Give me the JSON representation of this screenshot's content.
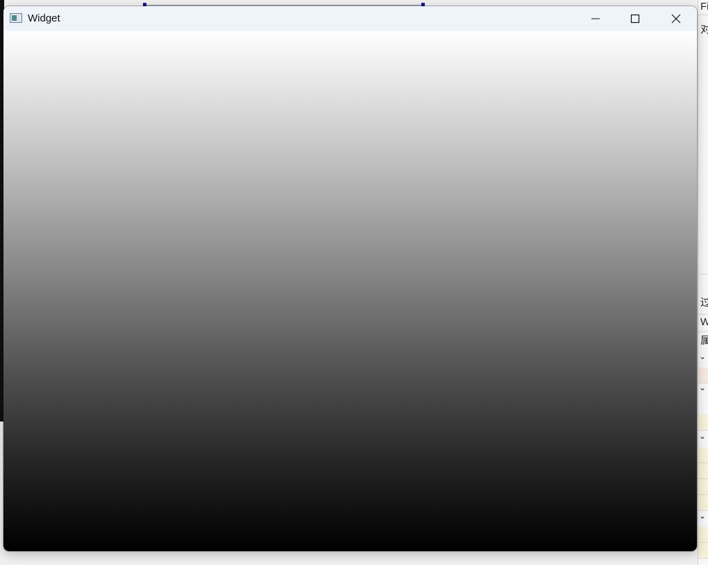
{
  "window": {
    "title": "Widget",
    "controls": {
      "minimize": "minimize",
      "maximize": "maximize",
      "close": "close"
    }
  },
  "client": {
    "gradient": [
      "#ffffff",
      "#000000"
    ]
  },
  "right_panel": {
    "text_1": "Fi",
    "text_2": "对",
    "text_3": "过",
    "text_4": "W",
    "text_5": "属"
  },
  "colors": {
    "titlebar": "#eff3fa",
    "selection_handle": "#1a1a8a",
    "highlight_row": "#f6f2d9"
  }
}
